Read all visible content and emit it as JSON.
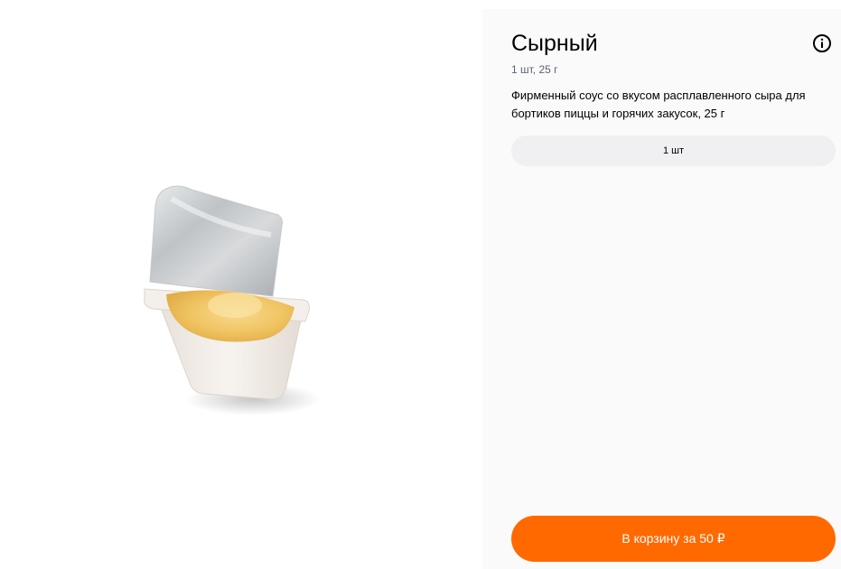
{
  "product": {
    "title": "Сырный",
    "meta": "1 шт, 25 г",
    "description": "Фирменный соус со вкусом расплавленного сыра для бортиков пиццы и горячих закусок, 25 г",
    "info_icon": "info-icon",
    "image_icon": "cheese-sauce-cup"
  },
  "size_selector": {
    "options": [
      "1 шт"
    ],
    "selected": "1 шт"
  },
  "cart_button": {
    "label": "В корзину за 50 ₽"
  },
  "colors": {
    "accent": "#ff6900",
    "panel_bg": "#fafafa",
    "selector_bg": "#f0f0f2",
    "meta_text": "#5c6370"
  }
}
